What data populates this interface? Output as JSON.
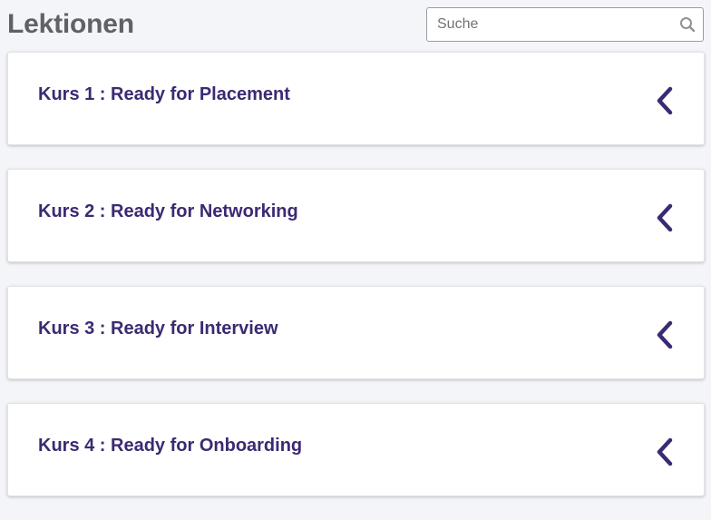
{
  "header": {
    "title": "Lektionen"
  },
  "search": {
    "placeholder": "Suche",
    "value": "",
    "icon": "search-icon"
  },
  "courses": [
    {
      "label": "Kurs 1 : Ready for Placement",
      "icon": "chevron-left-icon"
    },
    {
      "label": "Kurs 2 : Ready for Networking",
      "icon": "chevron-left-icon"
    },
    {
      "label": "Kurs 3 : Ready for Interview",
      "icon": "chevron-left-icon"
    },
    {
      "label": "Kurs 4 : Ready for Onboarding",
      "icon": "chevron-left-icon"
    }
  ],
  "colors": {
    "background": "#f4f5f8",
    "title": "#5f6166",
    "accent": "#3b2a72",
    "card": "#ffffff"
  }
}
